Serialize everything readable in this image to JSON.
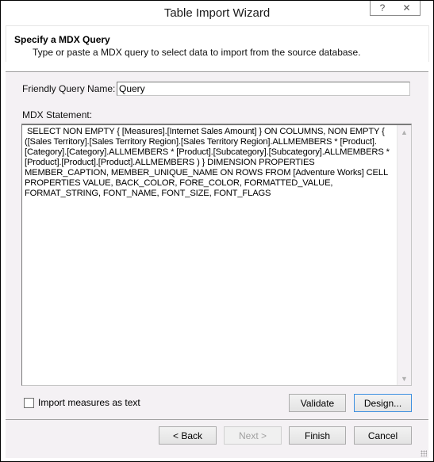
{
  "window": {
    "title": "Table Import Wizard",
    "help_icon": "?",
    "close_icon": "✕"
  },
  "header": {
    "title": "Specify a MDX Query",
    "subtitle": "Type or paste a MDX query to select data to import from the source database."
  },
  "form": {
    "friendly_name_label": "Friendly Query Name:",
    "friendly_name_value": "Query",
    "mdx_label": "MDX Statement:",
    "mdx_value": " SELECT NON EMPTY { [Measures].[Internet Sales Amount] } ON COLUMNS, NON EMPTY { ([Sales Territory].[Sales Territory Region].[Sales Territory Region].ALLMEMBERS * [Product].[Category].[Category].ALLMEMBERS * [Product].[Subcategory].[Subcategory].ALLMEMBERS * [Product].[Product].[Product].ALLMEMBERS ) } DIMENSION PROPERTIES MEMBER_CAPTION, MEMBER_UNIQUE_NAME ON ROWS FROM [Adventure Works] CELL PROPERTIES VALUE, BACK_COLOR, FORE_COLOR, FORMATTED_VALUE, FORMAT_STRING, FONT_NAME, FONT_SIZE, FONT_FLAGS",
    "scroll_up_icon": "▲",
    "scroll_down_icon": "▼",
    "import_measures_label": "Import measures as text",
    "import_measures_checked": false
  },
  "buttons": {
    "validate": "Validate",
    "design": "Design...",
    "back": "< Back",
    "next": "Next >",
    "finish": "Finish",
    "cancel": "Cancel"
  }
}
